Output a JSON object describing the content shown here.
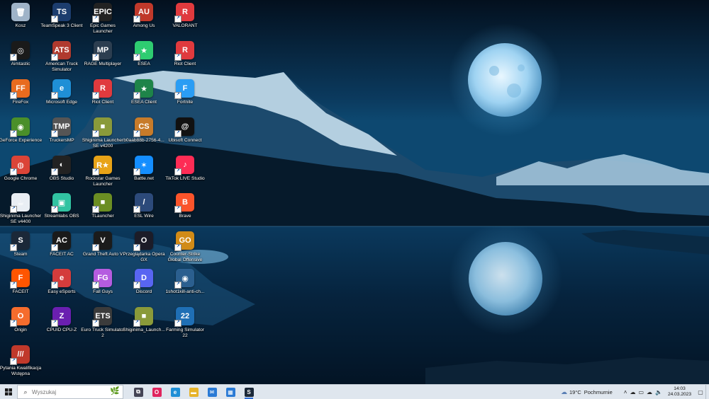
{
  "desktop": {
    "icons": [
      {
        "label": "Kosz",
        "color": "#9fb3c8",
        "glyph": "recycle-bin-icon",
        "mark": "🗑"
      },
      {
        "label": "TeamSpeak 3 Client",
        "color": "#1c3d6e",
        "glyph": "teamspeak-icon",
        "mark": "TS"
      },
      {
        "label": "Epic Games Launcher",
        "color": "#222222",
        "glyph": "epic-games-icon",
        "mark": "EPIC"
      },
      {
        "label": "Among Us",
        "color": "#c0392b",
        "glyph": "among-us-icon",
        "mark": "AU"
      },
      {
        "label": "VALORANT",
        "color": "#e03a3e",
        "glyph": "riot-icon",
        "mark": "R"
      },
      {
        "label": "Aimtastic",
        "color": "#1a1a1a",
        "glyph": "aimtastic-icon",
        "mark": "◎"
      },
      {
        "label": "American Truck Simulator",
        "color": "#b03a2e",
        "glyph": "truck-icon",
        "mark": "ATS"
      },
      {
        "label": "RAGE Multiplayer",
        "color": "#2c3e50",
        "glyph": "rage-mp-icon",
        "mark": "MP"
      },
      {
        "label": "ESEA",
        "color": "#2ecc71",
        "glyph": "esea-icon",
        "mark": "★"
      },
      {
        "label": "Riot Client",
        "color": "#e03a3e",
        "glyph": "riot-icon",
        "mark": "R"
      },
      {
        "label": "FireFox",
        "color": "#e86b1f",
        "glyph": "firefox-icon",
        "mark": "FF"
      },
      {
        "label": "Microsoft Edge",
        "color": "#1f8fd6",
        "glyph": "edge-icon",
        "mark": "e"
      },
      {
        "label": "Riot Client",
        "color": "#e03a3e",
        "glyph": "riot-icon",
        "mark": "R"
      },
      {
        "label": "ESEA Client",
        "color": "#1e8449",
        "glyph": "esea-icon",
        "mark": "★"
      },
      {
        "label": "Fortnite",
        "color": "#2a9df4",
        "glyph": "fortnite-icon",
        "mark": "F"
      },
      {
        "label": "GeForce Experience",
        "color": "#4a8f2a",
        "glyph": "nvidia-icon",
        "mark": "◉"
      },
      {
        "label": "TruckersMP",
        "color": "#555555",
        "glyph": "truckersmp-icon",
        "mark": "TMP"
      },
      {
        "label": "Shiginima Launcher SE v4200",
        "color": "#8a9a3a",
        "glyph": "minecraft-block-icon",
        "mark": "■"
      },
      {
        "label": "b0aab88b-2756-4...",
        "color": "#c77b2a",
        "glyph": "counter-strike-icon",
        "mark": "CS"
      },
      {
        "label": "Ubisoft Connect",
        "color": "#111111",
        "glyph": "ubisoft-icon",
        "mark": "@"
      },
      {
        "label": "Google Chrome",
        "color": "#db4437",
        "glyph": "chrome-icon",
        "mark": "◍"
      },
      {
        "label": "OBS Studio",
        "color": "#222222",
        "glyph": "obs-icon",
        "mark": "◐"
      },
      {
        "label": "Rockstar Games Launcher",
        "color": "#e8a317",
        "glyph": "rockstar-icon",
        "mark": "R★"
      },
      {
        "label": "Battle.net",
        "color": "#148eff",
        "glyph": "battlenet-icon",
        "mark": "✶"
      },
      {
        "label": "TikTok LIVE Studio",
        "color": "#fe2c55",
        "glyph": "tiktok-icon",
        "mark": "♪"
      },
      {
        "label": "Shiginima Launcher SE v4400",
        "color": "#e9eef4",
        "glyph": "java-icon",
        "mark": "☕"
      },
      {
        "label": "Streamlabs OBS",
        "color": "#31c3a2",
        "glyph": "streamlabs-icon",
        "mark": "▣"
      },
      {
        "label": "TLauncher",
        "color": "#6b8e23",
        "glyph": "minecraft-block-icon",
        "mark": "■"
      },
      {
        "label": "ESL Wire",
        "color": "#2c4a7a",
        "glyph": "esl-wire-icon",
        "mark": "/"
      },
      {
        "label": "Brave",
        "color": "#fb542b",
        "glyph": "brave-icon",
        "mark": "B"
      },
      {
        "label": "Steam",
        "color": "#1b2838",
        "glyph": "steam-icon",
        "mark": "S"
      },
      {
        "label": "FACEIT AC",
        "color": "#1a1a1a",
        "glyph": "faceit-icon",
        "mark": "AC"
      },
      {
        "label": "Grand Theft Auto V",
        "color": "#1b1b1b",
        "glyph": "gta-v-icon",
        "mark": "V"
      },
      {
        "label": "Przeglądarka Opera GX",
        "color": "#1c1c28",
        "glyph": "opera-gx-icon",
        "mark": "O"
      },
      {
        "label": "Counter-Strike Global Offensive",
        "color": "#d18b17",
        "glyph": "csgo-icon",
        "mark": "GO"
      },
      {
        "label": "FACEIT",
        "color": "#ff5500",
        "glyph": "faceit-icon",
        "mark": "F"
      },
      {
        "label": "Easy eSports",
        "color": "#d43c3c",
        "glyph": "easy-esports-icon",
        "mark": "e"
      },
      {
        "label": "Fall Guys",
        "color": "#b55ce0",
        "glyph": "fall-guys-icon",
        "mark": "FG"
      },
      {
        "label": "Discord",
        "color": "#5865f2",
        "glyph": "discord-icon",
        "mark": "D"
      },
      {
        "label": "1shot1kill-anti-ch...",
        "color": "#2b5f8f",
        "glyph": "eye-icon",
        "mark": "◉"
      },
      {
        "label": "Origin",
        "color": "#f56c2d",
        "glyph": "origin-icon",
        "mark": "O"
      },
      {
        "label": "CPUID CPU-Z",
        "color": "#6a1fb0",
        "glyph": "cpu-z-icon",
        "mark": "Z"
      },
      {
        "label": "Euro Truck Simulator 2",
        "color": "#3b3b3b",
        "glyph": "truck-icon",
        "mark": "ETS"
      },
      {
        "label": "Shiginima_Launch...",
        "color": "#8a9a3a",
        "glyph": "minecraft-block-icon",
        "mark": "■"
      },
      {
        "label": "Farming Simulator 22",
        "color": "#1f6fb5",
        "glyph": "farming-sim-icon",
        "mark": "22"
      },
      {
        "label": "Pytania Kwalifikacja Wstępna",
        "color": "#c0392b",
        "glyph": "document-icon",
        "mark": "///"
      }
    ]
  },
  "taskbar": {
    "search_placeholder": "Wyszukaj",
    "apps": [
      {
        "name": "task-view-icon",
        "mark": "⧉",
        "color": "#445"
      },
      {
        "name": "opera-gx-icon",
        "mark": "O",
        "color": "#e0245e"
      },
      {
        "name": "edge-icon",
        "mark": "e",
        "color": "#1f8fd6"
      },
      {
        "name": "file-explorer-icon",
        "mark": "▬",
        "color": "#e6b32a"
      },
      {
        "name": "mail-icon",
        "mark": "✉",
        "color": "#2a7ad5"
      },
      {
        "name": "store-icon",
        "mark": "▦",
        "color": "#2a7ad5"
      },
      {
        "name": "steam-icon",
        "mark": "S",
        "color": "#1b2838"
      }
    ],
    "weather": {
      "temp": "19°C",
      "condition": "Pochmurnie"
    },
    "clock": {
      "time": "14:03",
      "date": "24.03.2023"
    }
  }
}
